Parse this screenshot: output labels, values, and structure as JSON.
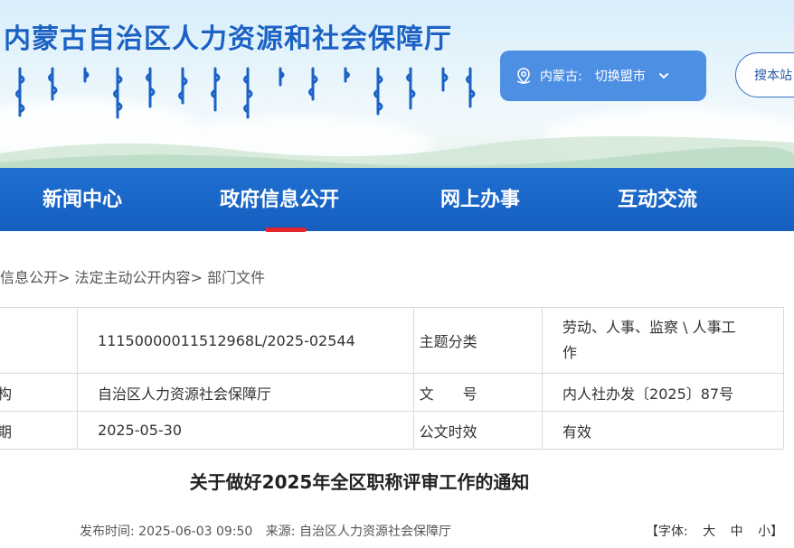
{
  "header": {
    "site_title": "内蒙古自治区人力资源和社会保障厅",
    "region_prefix": "内蒙古:",
    "region_switch": "切换盟市",
    "search_label": "搜本站"
  },
  "nav": {
    "items": [
      "新闻中心",
      "政府信息公开",
      "网上办事",
      "互动交流"
    ],
    "active_index": 1,
    "accent": "#e4242a"
  },
  "breadcrumb": [
    "府信息公开",
    "法定主动公开内容",
    "部门文件"
  ],
  "info": {
    "index_no": "11150000011512968L/2025-02544",
    "topic_key": "主题分类",
    "topic_val_line1": "劳动、人事、监察 \\ 人事工",
    "topic_val_line2": "作",
    "org_key_tail": "构",
    "org_val": "自治区人力资源社会保障厅",
    "docno_key": "文　　号",
    "docno_val": "内人社办发〔2025〕87号",
    "date_key_tail": "期",
    "date_val": "2025-05-30",
    "validity_key": "公文时效",
    "validity_val": "有效"
  },
  "article": {
    "title": "关于做好2025年全区职称评审工作的通知",
    "publish_label": "发布时间:",
    "publish_time": "2025-06-03 09:50",
    "source_label": "来源:",
    "source": "自治区人力资源社会保障厅",
    "font_label": "【字体:",
    "font_large": "大",
    "font_medium": "中",
    "font_small": "小】"
  }
}
